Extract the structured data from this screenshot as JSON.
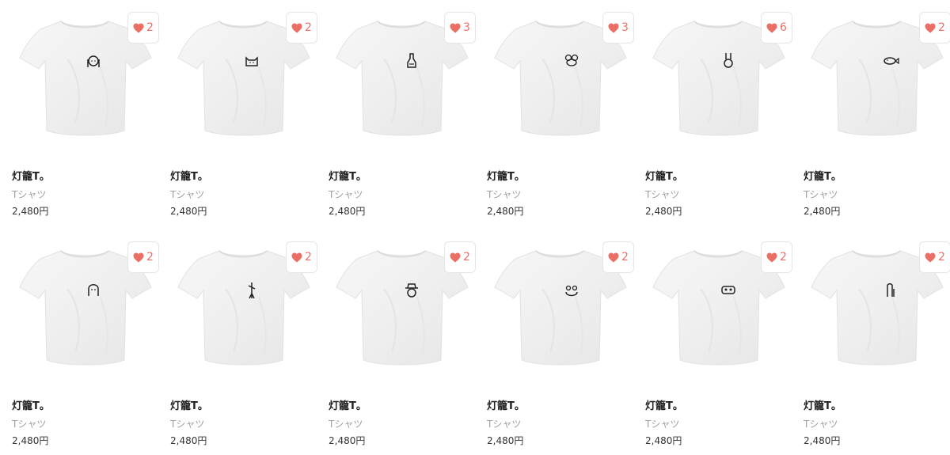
{
  "products": [
    {
      "title": "灯籠T。",
      "category": "Tシャツ",
      "price": "2,480円",
      "likes": "2",
      "print_icon": "girl-face-icon"
    },
    {
      "title": "灯籠T。",
      "category": "Tシャツ",
      "price": "2,480円",
      "likes": "2",
      "print_icon": "cat-face-icon"
    },
    {
      "title": "灯籠T。",
      "category": "Tシャツ",
      "price": "2,480円",
      "likes": "3",
      "print_icon": "bottle-icon"
    },
    {
      "title": "灯籠T。",
      "category": "Tシャツ",
      "price": "2,480円",
      "likes": "3",
      "print_icon": "mouse-icon"
    },
    {
      "title": "灯籠T。",
      "category": "Tシャツ",
      "price": "2,480円",
      "likes": "6",
      "print_icon": "rabbit-icon"
    },
    {
      "title": "灯籠T。",
      "category": "Tシャツ",
      "price": "2,480円",
      "likes": "2",
      "print_icon": "fish-icon"
    },
    {
      "title": "灯籠T。",
      "category": "Tシャツ",
      "price": "2,480円",
      "likes": "2",
      "print_icon": "ghost-face-icon"
    },
    {
      "title": "灯籠T。",
      "category": "Tシャツ",
      "price": "2,480円",
      "likes": "2",
      "print_icon": "stick-figure-icon"
    },
    {
      "title": "灯籠T。",
      "category": "Tシャツ",
      "price": "2,480円",
      "likes": "2",
      "print_icon": "hat-face-icon"
    },
    {
      "title": "灯籠T。",
      "category": "Tシャツ",
      "price": "2,480円",
      "likes": "2",
      "print_icon": "frog-icon"
    },
    {
      "title": "灯籠T。",
      "category": "Tシャツ",
      "price": "2,480円",
      "likes": "2",
      "print_icon": "mask-face-icon"
    },
    {
      "title": "灯籠T。",
      "category": "Tシャツ",
      "price": "2,480円",
      "likes": "2",
      "print_icon": "penguin-icon"
    }
  ],
  "colors": {
    "heart": "#ec6f66",
    "title": "#222222",
    "category": "#a0a0a0"
  }
}
